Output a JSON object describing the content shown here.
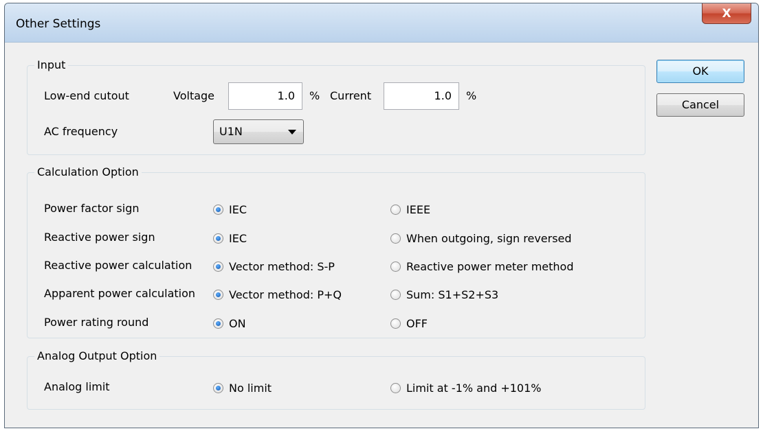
{
  "window": {
    "title": "Other Settings",
    "close_label": "X"
  },
  "buttons": {
    "ok": "OK",
    "cancel": "Cancel"
  },
  "input_group": {
    "title": "Input",
    "low_end_cutout_label": "Low-end cutout",
    "voltage_label": "Voltage",
    "voltage_value": "1.0",
    "voltage_unit": "%",
    "current_label": "Current",
    "current_value": "1.0",
    "current_unit": "%",
    "ac_frequency_label": "AC frequency",
    "ac_frequency_value": "U1N"
  },
  "calc_group": {
    "title": "Calculation Option",
    "rows": [
      {
        "label": "Power factor sign",
        "opt1": "IEC",
        "opt2": "IEEE",
        "selected": 1
      },
      {
        "label": "Reactive power sign",
        "opt1": "IEC",
        "opt2": "When outgoing, sign reversed",
        "selected": 1
      },
      {
        "label": "Reactive power calculation",
        "opt1": "Vector method: S-P",
        "opt2": "Reactive power meter method",
        "selected": 1
      },
      {
        "label": "Apparent power calculation",
        "opt1": "Vector method: P+Q",
        "opt2": "Sum: S1+S2+S3",
        "selected": 1
      },
      {
        "label": "Power rating round",
        "opt1": "ON",
        "opt2": "OFF",
        "selected": 1
      }
    ]
  },
  "analog_group": {
    "title": "Analog Output Option",
    "label": "Analog limit",
    "opt1": "No limit",
    "opt2": "Limit at -1% and +101%",
    "selected": 1
  }
}
